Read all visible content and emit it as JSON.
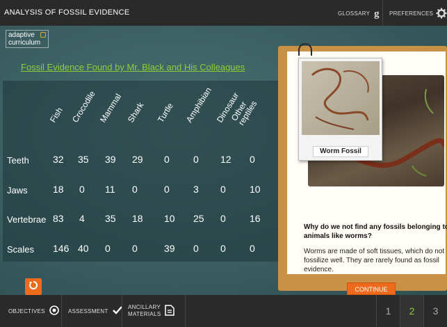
{
  "header": {
    "title": "ANALYSIS OF FOSSIL EVIDENCE",
    "glossary_label": "GLOSSARY",
    "preferences_label": "PREFERENCES"
  },
  "logo": {
    "line1": "adaptive",
    "line2": "curriculum"
  },
  "table": {
    "title": "Fossil Evidence Found by Mr. Black and His Colleagues",
    "columns": [
      "Fish",
      "Crocodile",
      "Mammal",
      "Shark",
      "Turtle",
      "Amphibian",
      "Dinosaur",
      "Other reptiles"
    ],
    "rows": [
      {
        "label": "Teeth",
        "values": [
          "32",
          "35",
          "39",
          "29",
          "0",
          "0",
          "12",
          "0"
        ]
      },
      {
        "label": "Jaws",
        "values": [
          "18",
          "0",
          "11",
          "0",
          "0",
          "3",
          "0",
          "10"
        ]
      },
      {
        "label": "Vertebrae",
        "values": [
          "83",
          "4",
          "35",
          "18",
          "10",
          "25",
          "0",
          "16"
        ]
      },
      {
        "label": "Scales",
        "values": [
          "146",
          "40",
          "0",
          "0",
          "39",
          "0",
          "0",
          "0"
        ]
      }
    ]
  },
  "card": {
    "photo_caption": "Worm Fossil",
    "question": "Why do we not find any fossils belonging to animals like worms?",
    "answer": "Worms are made of soft tissues, which do not fossilize well. They are rarely found as fossil evidence.",
    "continue_label": "CONTINUE"
  },
  "footer": {
    "objectives_label": "OBJECTIVES",
    "assessment_label": "ASSESSMENT",
    "ancillary_label_1": "ANCILLARY",
    "ancillary_label_2": "MATERIALS",
    "pages": [
      "1",
      "2",
      "3"
    ],
    "active_page": "2"
  },
  "colors": {
    "accent_green": "#8bcf3b",
    "accent_orange": "#ee6a1c",
    "card_border": "#c99145"
  }
}
